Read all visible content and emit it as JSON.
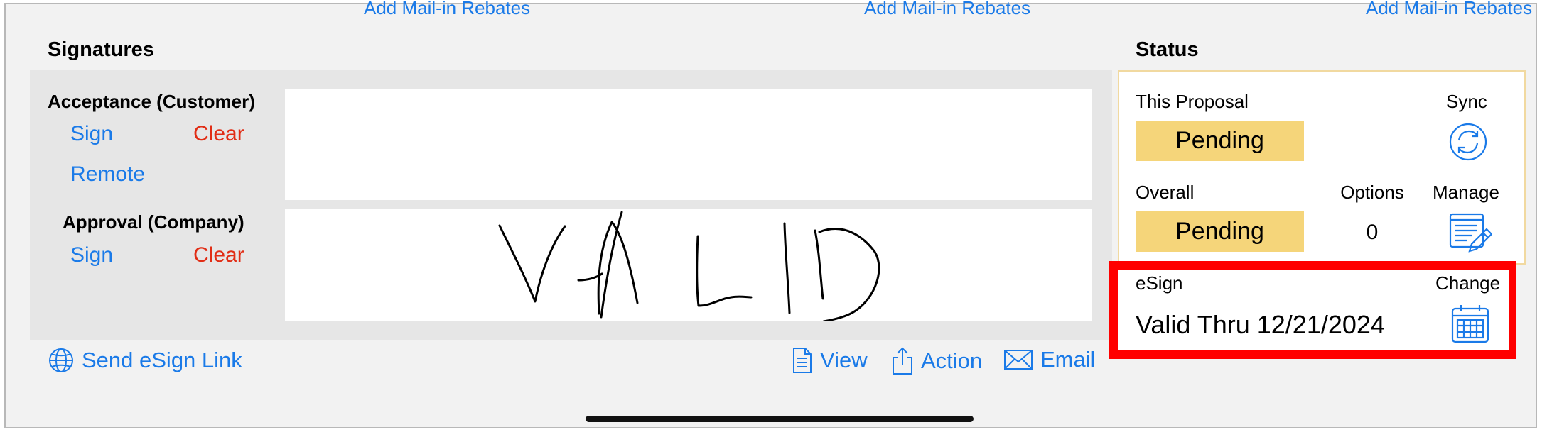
{
  "top_links": [
    "Add Mail-in Rebates",
    "Add Mail-in Rebates",
    "Add Mail-in Rebates"
  ],
  "signatures": {
    "title": "Signatures",
    "acceptance": {
      "label": "Acceptance (Customer)",
      "sign": "Sign",
      "clear": "Clear",
      "remote": "Remote"
    },
    "approval": {
      "label": "Approval (Company)",
      "sign": "Sign",
      "clear": "Clear"
    },
    "signature_text": "VALID"
  },
  "footer": {
    "send_link": "Send eSign Link",
    "view": "View",
    "action": "Action",
    "email": "Email"
  },
  "status": {
    "title": "Status",
    "this_proposal_label": "This Proposal",
    "this_proposal_value": "Pending",
    "sync_label": "Sync",
    "overall_label": "Overall",
    "overall_value": "Pending",
    "options_label": "Options",
    "options_value": "0",
    "manage_label": "Manage",
    "esign_label": "eSign",
    "change_label": "Change",
    "esign_value": "Valid Thru 12/21/2024"
  },
  "colors": {
    "accent": "#1a7ae8",
    "destructive": "#e12d15",
    "pending": "#f5d57a",
    "highlight": "#ff0000"
  },
  "icons": [
    "globe-icon",
    "document-icon",
    "share-icon",
    "envelope-icon",
    "sync-icon",
    "manage-list-icon",
    "calendar-icon"
  ]
}
